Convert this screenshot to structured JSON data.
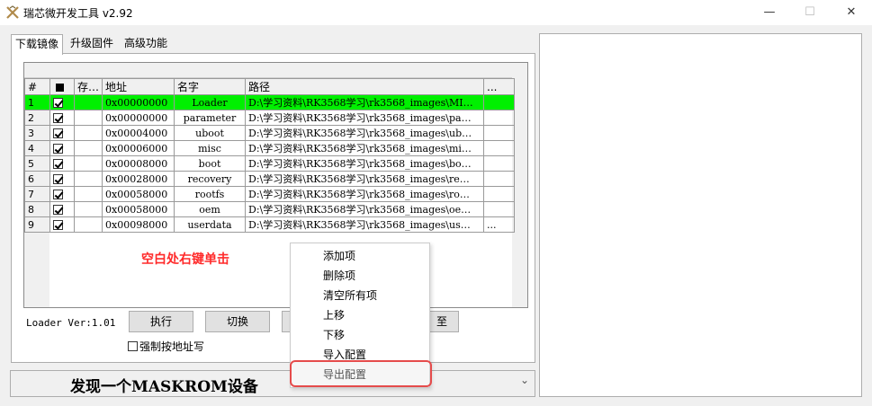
{
  "window": {
    "title": "瑞芯微开发工具 v2.92",
    "minimize_glyph": "—",
    "maximize_glyph": "☐",
    "close_glyph": "✕"
  },
  "tabs": [
    {
      "label": "下载镜像",
      "active": true
    },
    {
      "label": "升级固件",
      "active": false
    },
    {
      "label": "高级功能",
      "active": false
    }
  ],
  "grid": {
    "headers": {
      "num": "#",
      "check": "",
      "storage": "存…",
      "address": "地址",
      "name": "名字",
      "path": "路径",
      "more": "..."
    },
    "rows": [
      {
        "num": "1",
        "checked": true,
        "address": "0x00000000",
        "name": "Loader",
        "path": "D:\\学习资料\\RK3568学习\\rk3568_images\\MI…",
        "more": "",
        "highlighted": true
      },
      {
        "num": "2",
        "checked": true,
        "address": "0x00000000",
        "name": "parameter",
        "path": "D:\\学习资料\\RK3568学习\\rk3568_images\\pa…",
        "more": "",
        "highlighted": false
      },
      {
        "num": "3",
        "checked": true,
        "address": "0x00004000",
        "name": "uboot",
        "path": "D:\\学习资料\\RK3568学习\\rk3568_images\\ub…",
        "more": "",
        "highlighted": false
      },
      {
        "num": "4",
        "checked": true,
        "address": "0x00006000",
        "name": "misc",
        "path": "D:\\学习资料\\RK3568学习\\rk3568_images\\mi…",
        "more": "",
        "highlighted": false
      },
      {
        "num": "5",
        "checked": true,
        "address": "0x00008000",
        "name": "boot",
        "path": "D:\\学习资料\\RK3568学习\\rk3568_images\\bo…",
        "more": "",
        "highlighted": false
      },
      {
        "num": "6",
        "checked": true,
        "address": "0x00028000",
        "name": "recovery",
        "path": "D:\\学习资料\\RK3568学习\\rk3568_images\\re…",
        "more": "",
        "highlighted": false
      },
      {
        "num": "7",
        "checked": true,
        "address": "0x00058000",
        "name": "rootfs",
        "path": "D:\\学习资料\\RK3568学习\\rk3568_images\\ro…",
        "more": "",
        "highlighted": false
      },
      {
        "num": "8",
        "checked": true,
        "address": "0x00058000",
        "name": "oem",
        "path": "D:\\学习资料\\RK3568学习\\rk3568_images\\oe…",
        "more": "",
        "highlighted": false
      },
      {
        "num": "9",
        "checked": true,
        "address": "0x00098000",
        "name": "userdata",
        "path": "D:\\学习资料\\RK3568学习\\rk3568_images\\us…",
        "more": "...",
        "highlighted": false
      }
    ]
  },
  "annotation": "空白处右键单击",
  "loader_version": "Loader Ver:1.01",
  "buttons": {
    "run": "执行",
    "switch": "切换",
    "partial_right": "至"
  },
  "force_address_write": {
    "label": "强制按地址写",
    "checked": false
  },
  "status": {
    "message": "发现一个MASKROM设备",
    "dropdown_arrow": "⌄"
  },
  "context_menu": {
    "items": [
      "添加项",
      "删除项",
      "清空所有项",
      "上移",
      "下移",
      "导入配置",
      "导出配置"
    ],
    "highlighted_item": "导出配置"
  },
  "colors": {
    "selected_row": "#00f000",
    "annotation_red": "#ff2a2a",
    "highlight_border": "#e54b4b"
  }
}
